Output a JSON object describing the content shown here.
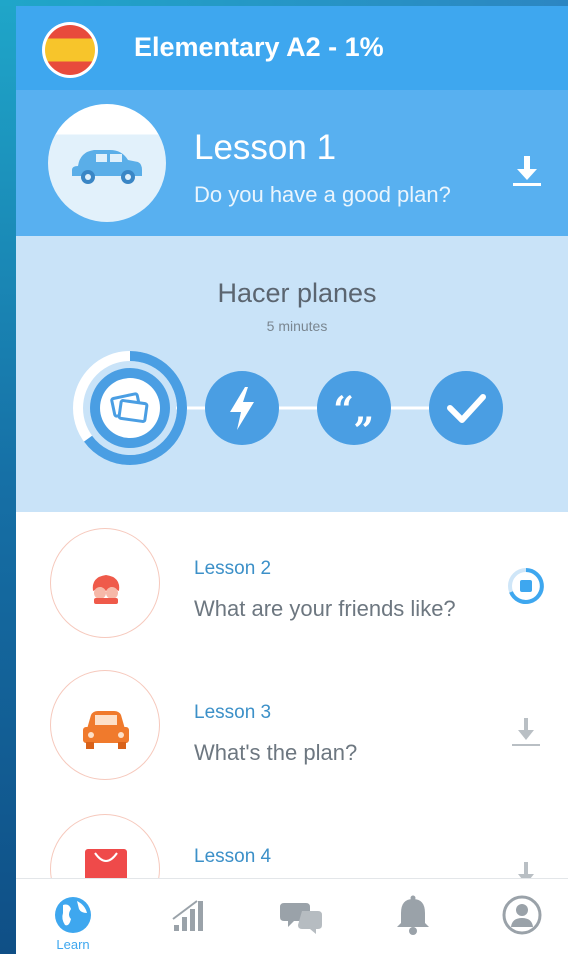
{
  "header": {
    "title": "Elementary A2 - 1%",
    "flag_icon": "spain-flag-icon",
    "colors": {
      "bar": "#3ea7ef"
    }
  },
  "current_lesson": {
    "label": "Lesson 1",
    "title": "Do you have a good plan?",
    "image_icon": "car-icon",
    "action_icon": "download-icon"
  },
  "expanded": {
    "title": "Hacer planes",
    "duration": "5 minutes",
    "progress_fraction": 0.65,
    "steps": [
      {
        "icon": "flashcards-icon",
        "active": true
      },
      {
        "icon": "lightning-icon",
        "active": false
      },
      {
        "icon": "quote-icon",
        "active": false
      },
      {
        "icon": "check-icon",
        "active": false
      }
    ]
  },
  "lessons": [
    {
      "label": "Lesson 2",
      "title": "What are your friends like?",
      "image_icon": "friends-icon",
      "action_icon": "downloading-icon"
    },
    {
      "label": "Lesson 3",
      "title": "What's the plan?",
      "image_icon": "car-front-icon",
      "action_icon": "download-icon"
    },
    {
      "label": "Lesson 4",
      "title": "",
      "image_icon": "shopping-bag-icon",
      "action_icon": "download-icon"
    }
  ],
  "nav": {
    "items": [
      {
        "icon": "globe-icon",
        "label": "Learn",
        "active": true
      },
      {
        "icon": "stats-icon",
        "label": ""
      },
      {
        "icon": "chat-icon",
        "label": ""
      },
      {
        "icon": "bell-icon",
        "label": ""
      },
      {
        "icon": "profile-icon",
        "label": ""
      }
    ],
    "colors": {
      "active": "#3ea7ef",
      "inactive": "#9aa2a9"
    }
  }
}
